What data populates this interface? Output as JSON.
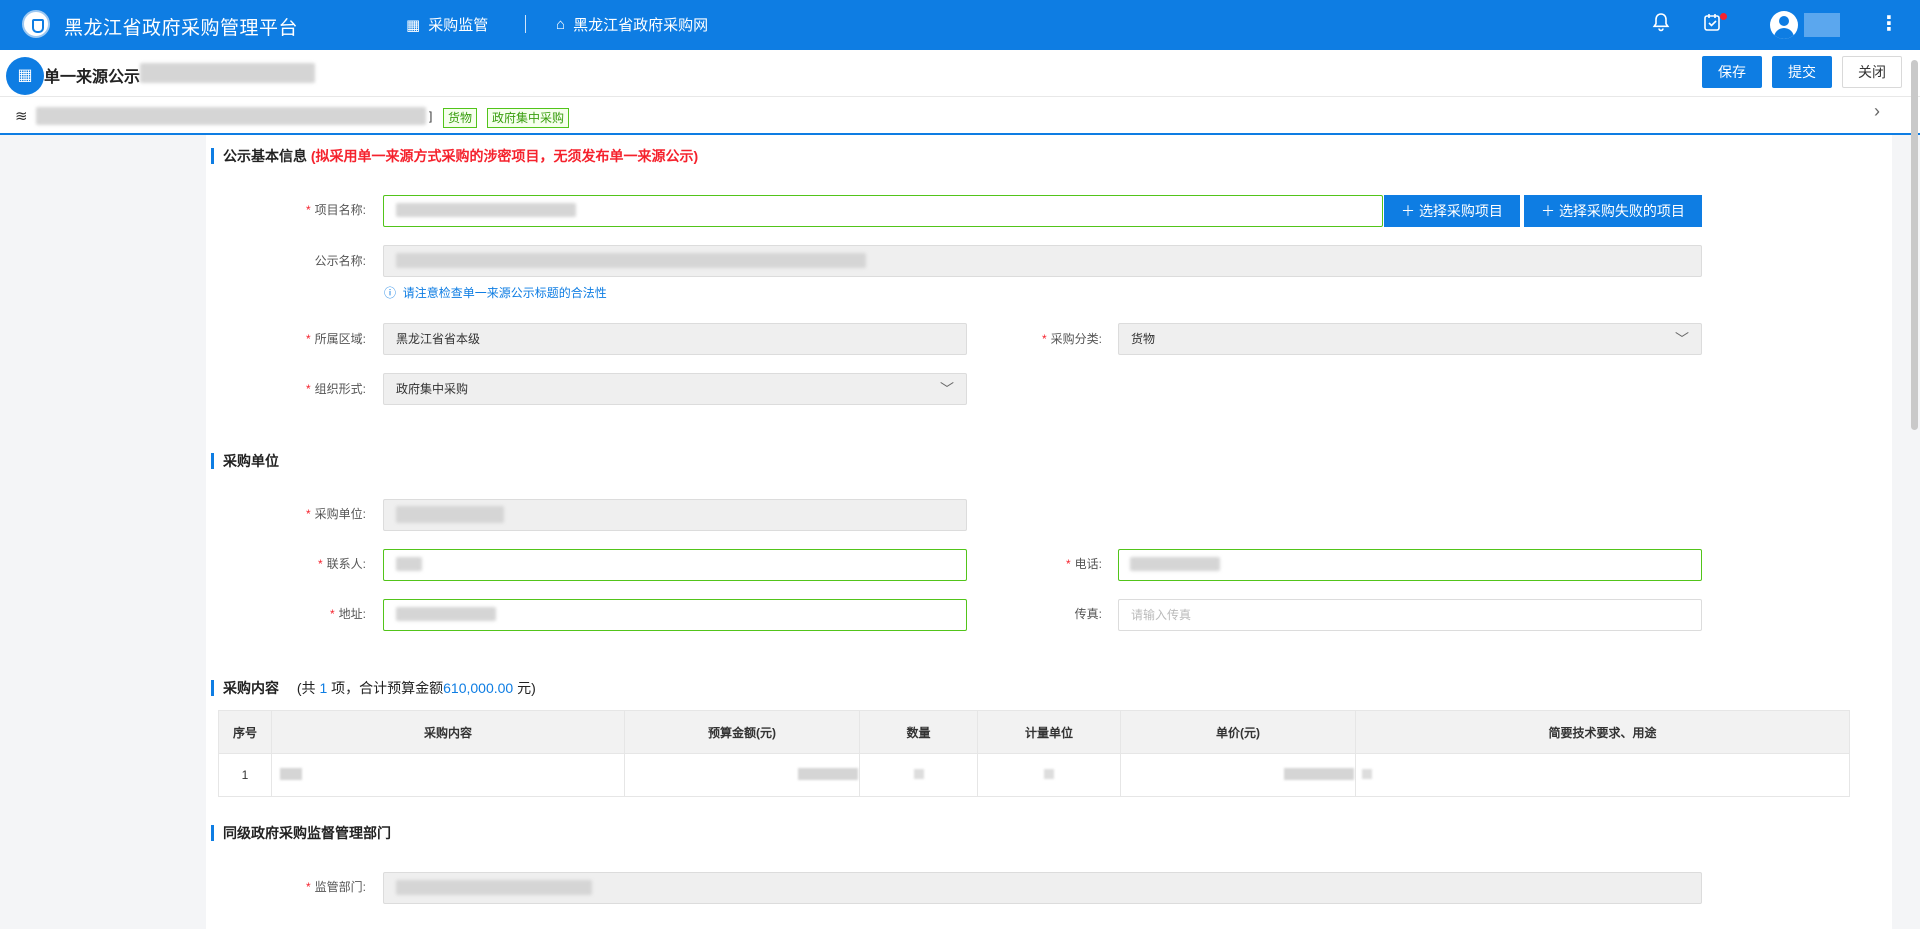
{
  "header": {
    "app_title": "黑龙江省政府采购管理平台",
    "nav": [
      {
        "label": "采购监管",
        "icon": "grid-icon"
      },
      {
        "label": "黑龙江省政府采购网",
        "icon": "home-icon"
      }
    ],
    "icons": [
      "bell-icon",
      "task-icon",
      "user-avatar-icon",
      "more-vertical-icon"
    ]
  },
  "page": {
    "title": "单一来源公示",
    "actions": {
      "save": "保存",
      "submit": "提交",
      "close": "关闭"
    },
    "breadcrumb_close": "]",
    "tags": [
      "货物",
      "政府集中采购"
    ]
  },
  "basic_info": {
    "section_title": "公示基本信息",
    "warning": "(拟采用单一来源方式采购的涉密项目，无须发布单一来源公示)",
    "project_name_label": "项目名称:",
    "select_project_btn": "选择采购项目",
    "select_failed_btn": "选择采购失败的项目",
    "notice_name_label": "公示名称:",
    "notice_hint": "请注意检查单一来源公示标题的合法性",
    "region_label": "所属区域:",
    "region_value": "黑龙江省省本级",
    "category_label": "采购分类:",
    "category_value": "货物",
    "org_form_label": "组织形式:",
    "org_form_value": "政府集中采购"
  },
  "buyer": {
    "section_title": "采购单位",
    "unit_label": "采购单位:",
    "contact_label": "联系人:",
    "phone_label": "电话:",
    "address_label": "地址:",
    "fax_label": "传真:",
    "fax_placeholder": "请输入传真"
  },
  "content": {
    "section_title": "采购内容",
    "summary_prefix": "(共",
    "count": "1",
    "summary_mid": "项，合计预算金额",
    "total": "610,000.00",
    "summary_suffix": "元)",
    "columns": [
      "序号",
      "采购内容",
      "预算金额(元)",
      "数量",
      "计量单位",
      "单价(元)",
      "简要技术要求、用途"
    ],
    "rows": [
      {
        "index": "1"
      }
    ]
  },
  "supervision": {
    "section_title": "同级政府采购监督管理部门",
    "dept_label": "监管部门:"
  },
  "colors": {
    "primary": "#0e7de3",
    "required": "#f5222d",
    "tag_green": "#52c41a"
  }
}
